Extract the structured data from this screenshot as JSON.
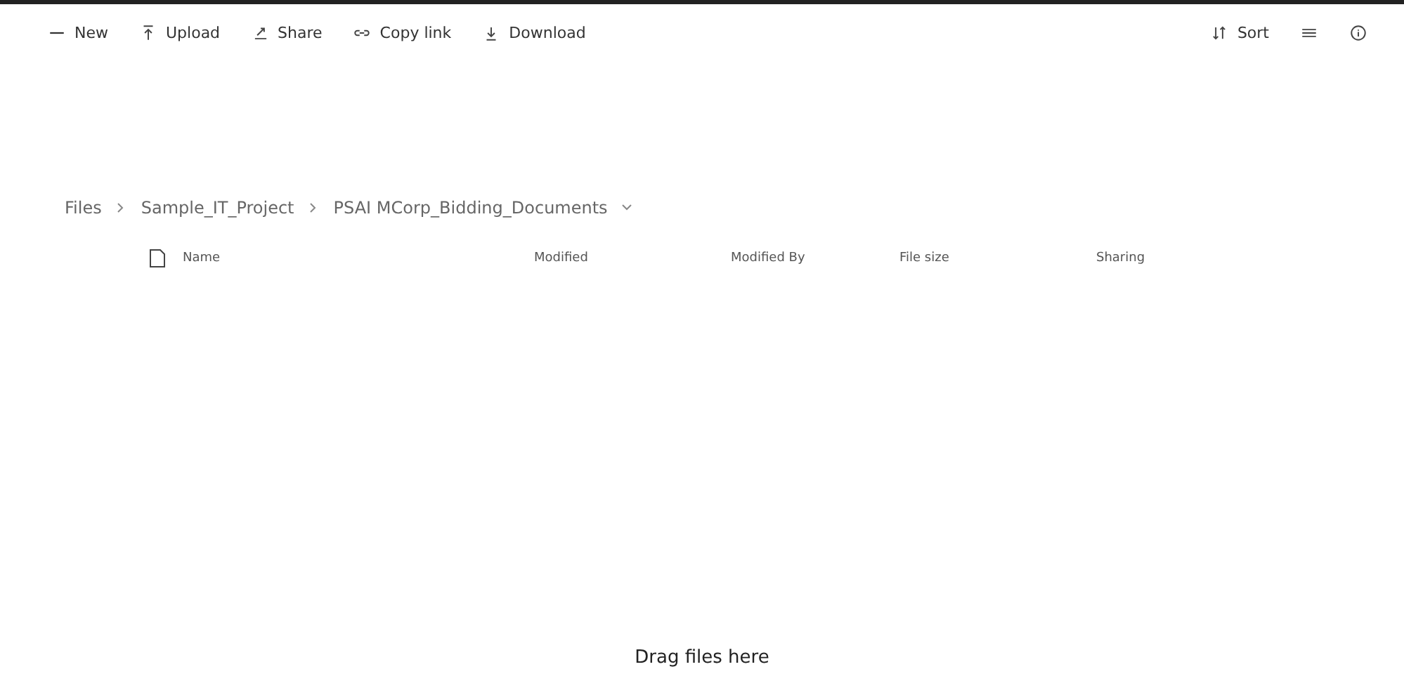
{
  "toolbar": {
    "left": [
      {
        "kind": "new",
        "label": "New"
      },
      {
        "kind": "upload",
        "label": "Upload"
      },
      {
        "kind": "share",
        "label": "Share"
      },
      {
        "kind": "link",
        "label": "Copy link"
      },
      {
        "kind": "download",
        "label": "Download"
      }
    ],
    "right": [
      {
        "kind": "sort",
        "label": "Sort"
      },
      {
        "kind": "view"
      },
      {
        "kind": "info"
      }
    ]
  },
  "breadcrumb": [
    "Files",
    "Sample_IT_Project",
    "PSAI MCorp_Bidding_Documents"
  ],
  "table": {
    "columns": [
      "Name",
      "Modified",
      "Modified By",
      "File size",
      "Sharing"
    ]
  },
  "drop_hint": "Drag files here"
}
